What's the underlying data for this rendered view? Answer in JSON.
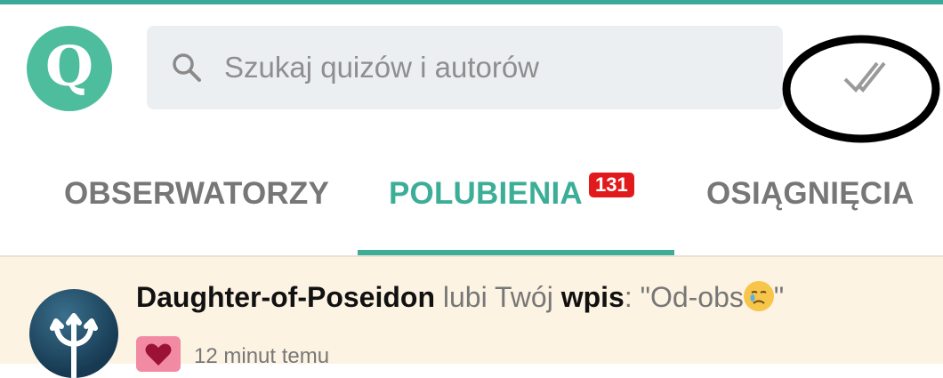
{
  "app": {
    "logo_letter": "Q",
    "accent_color": "#3cae97"
  },
  "search": {
    "placeholder": "Szukaj quizów i autorów",
    "icon": "search-icon"
  },
  "toolbar": {
    "mark_read_icon": "double-check-icon"
  },
  "tabs": [
    {
      "label": "OBSERWATORZY",
      "active": false
    },
    {
      "label": "POLUBIENIA",
      "active": true,
      "badge": "131"
    },
    {
      "label": "OSIĄGNIĘCIA",
      "active": false
    }
  ],
  "notification": {
    "user": "Daughter-of-Poseidon",
    "action": "lubi Twój",
    "object": "wpis",
    "sep": ":",
    "quote": "\"Od-obs",
    "quote_end": "\"",
    "time": "12 minut temu",
    "type_icon": "heart-icon"
  }
}
